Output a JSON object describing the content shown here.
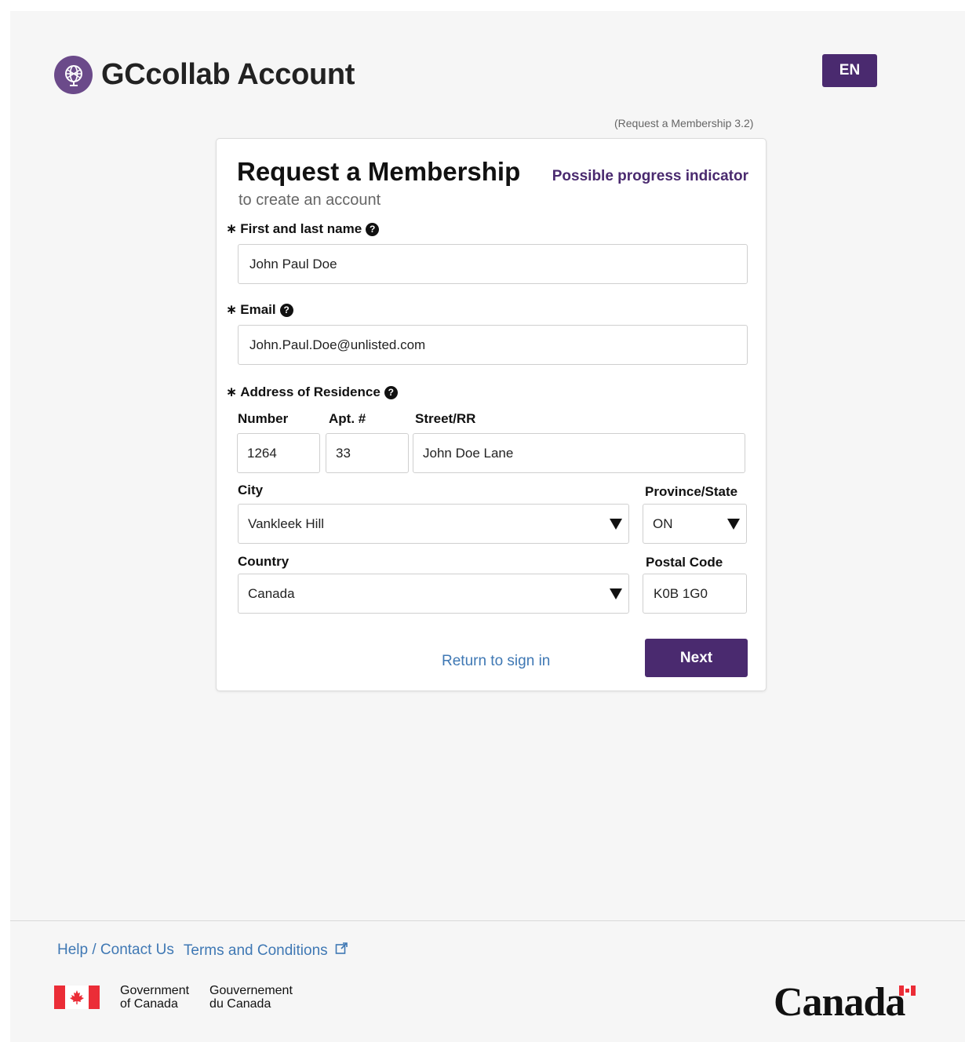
{
  "app": {
    "title": "GCcollab Account",
    "language_button": "EN",
    "screen_ref": "(Request a Membership 3.2)"
  },
  "form": {
    "title": "Request a Membership",
    "subtitle": "to create an account",
    "progress_link": "Possible progress indicator",
    "required_marker": "∗",
    "help_glyph": "?",
    "name": {
      "label": "First and last name",
      "value": "John Paul Doe"
    },
    "email": {
      "label": "Email",
      "value": "John.Paul.Doe@unlisted.com"
    },
    "address": {
      "label": "Address of Residence",
      "number": {
        "label": "Number",
        "value": "1264"
      },
      "apt": {
        "label": "Apt. #",
        "value": "33"
      },
      "street": {
        "label": "Street/RR",
        "value": "John Doe Lane"
      },
      "city": {
        "label": "City",
        "value": "Vankleek Hill"
      },
      "province": {
        "label": "Province/State",
        "value": "ON"
      },
      "country": {
        "label": "Country",
        "value": "Canada"
      },
      "postal": {
        "label": "Postal Code",
        "value": "K0B 1G0"
      }
    },
    "return_link": "Return to sign in",
    "next_button": "Next"
  },
  "footer": {
    "help_link": "Help / Contact Us",
    "terms_link": "Terms and Conditions",
    "gov_en_line1": "Government",
    "gov_en_line2": "of Canada",
    "gov_fr_line1": "Gouvernement",
    "gov_fr_line2": "du Canada",
    "wordmark": "Canada"
  },
  "colors": {
    "accent": "#4a2a6f",
    "link": "#3f78b4",
    "flag_red": "#eb2d37"
  },
  "icons": [
    "globe-logo-icon",
    "help-icon",
    "dropdown-caret-icon",
    "external-link-icon",
    "maple-leaf-icon"
  ]
}
